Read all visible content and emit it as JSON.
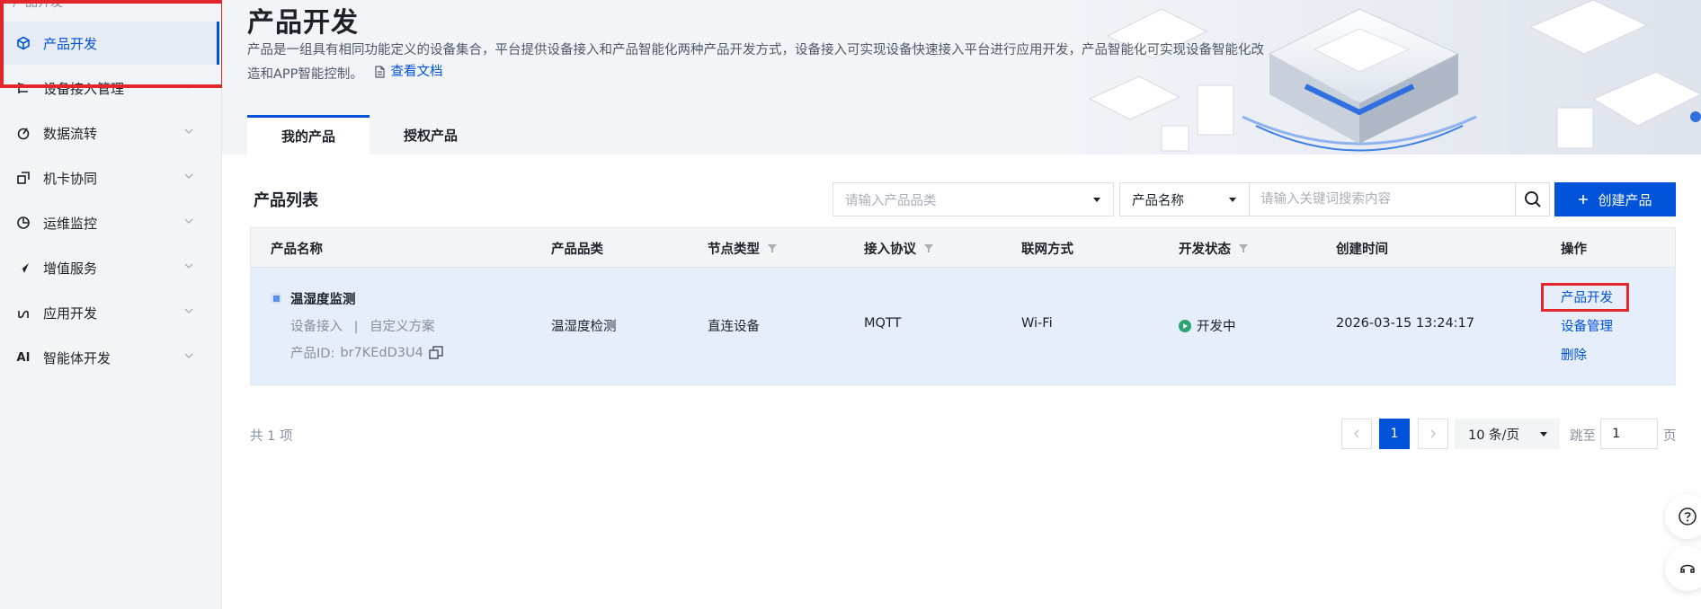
{
  "sidebar": {
    "top_stub": "产品开发",
    "items": [
      {
        "label": "产品开发",
        "icon": "cube-icon"
      },
      {
        "label": "设备接入管理",
        "icon": "device-icon"
      },
      {
        "label": "数据流转",
        "icon": "flow-icon"
      },
      {
        "label": "机卡协同",
        "icon": "sim-icon"
      },
      {
        "label": "运维监控",
        "icon": "monitor-icon"
      },
      {
        "label": "增值服务",
        "icon": "send-icon"
      },
      {
        "label": "应用开发",
        "icon": "app-icon"
      },
      {
        "label": "智能体开发",
        "icon": "ai-icon"
      }
    ],
    "ai_glyph": "AI"
  },
  "header": {
    "title": "产品开发",
    "description": "产品是一组具有相同功能定义的设备集合，平台提供设备接入和产品智能化两种产品开发方式，设备接入可实现设备快速接入平台进行应用开发，产品智能化可实现设备智能化改造和APP智能控制。",
    "doc_link": "查看文档"
  },
  "tabs": [
    {
      "label": "我的产品",
      "active": true
    },
    {
      "label": "授权产品",
      "active": false
    }
  ],
  "toolbar": {
    "list_title": "产品列表",
    "category_placeholder": "请输入产品品类",
    "filter_field": "产品名称",
    "search_placeholder": "请输入关键词搜索内容",
    "create_label": "创建产品"
  },
  "table": {
    "columns": [
      "产品名称",
      "产品品类",
      "节点类型",
      "接入协议",
      "联网方式",
      "开发状态",
      "创建时间",
      "操作"
    ],
    "rows": [
      {
        "name": "温湿度监测",
        "access_type": "设备接入",
        "separator": "|",
        "scheme": "自定义方案",
        "product_id_label": "产品ID:",
        "product_id": "br7KEdD3U4",
        "category": "温湿度检测",
        "node_type": "直连设备",
        "protocol": "MQTT",
        "network": "Wi-Fi",
        "status": "开发中",
        "created": "2026-03-15 13:24:17",
        "actions": [
          "产品开发",
          "设备管理",
          "删除"
        ]
      }
    ]
  },
  "pagination": {
    "total": "共 1 项",
    "current_page": "1",
    "page_size": "10 条/页",
    "jump_label": "跳至",
    "jump_value": "1",
    "page_suffix": "页"
  },
  "colors": {
    "primary": "#0052d9",
    "highlight": "#e3262c",
    "status_dev": "#2ba471"
  }
}
